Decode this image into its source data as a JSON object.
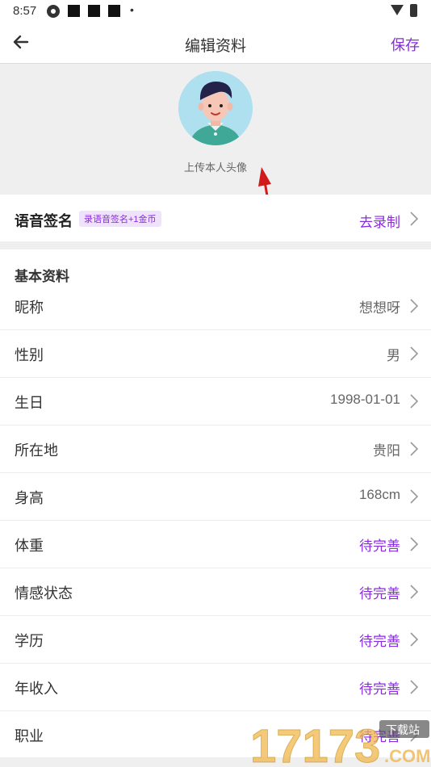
{
  "status_bar": {
    "time": "8:57",
    "icons": [
      "settings-icon",
      "square-icon",
      "square-icon",
      "square-icon",
      "dot-icon",
      "wifi-icon",
      "battery-icon"
    ]
  },
  "navbar": {
    "back_icon": "arrow-left-icon",
    "title": "编辑资料",
    "save_label": "保存"
  },
  "avatar": {
    "hint": "上传本人头像"
  },
  "voice_signature": {
    "label": "语音签名",
    "badge": "录语音签名+1金币",
    "action": "去录制"
  },
  "basic_info": {
    "title": "基本资料",
    "rows": [
      {
        "label": "昵称",
        "value": "想想呀",
        "pending": false
      },
      {
        "label": "性别",
        "value": "男",
        "pending": false
      },
      {
        "label": "生日",
        "value": "1998-01-01",
        "pending": false
      },
      {
        "label": "所在地",
        "value": "贵阳",
        "pending": false
      },
      {
        "label": "身高",
        "value": "168cm",
        "pending": false
      },
      {
        "label": "体重",
        "value": "待完善",
        "pending": true
      },
      {
        "label": "情感状态",
        "value": "待完善",
        "pending": true
      },
      {
        "label": "学历",
        "value": "待完善",
        "pending": true
      },
      {
        "label": "年收入",
        "value": "待完善",
        "pending": true
      },
      {
        "label": "职业",
        "value": "待完善",
        "pending": true
      }
    ]
  },
  "watermark": {
    "text": "17173",
    "sub": "下载站",
    "domain": ".COM"
  },
  "colors": {
    "accent": "#8a2be2",
    "background_gray": "#efefef",
    "annotation_arrow": "#d11a1a"
  }
}
